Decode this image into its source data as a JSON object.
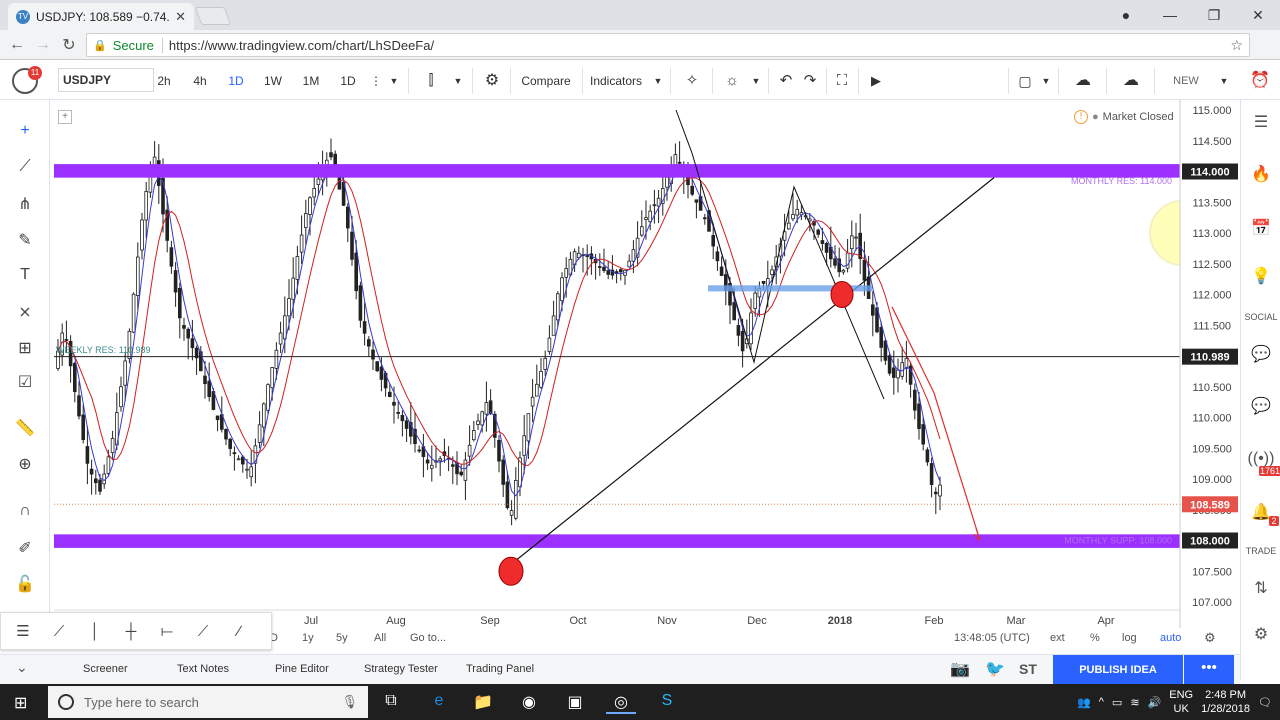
{
  "browser": {
    "tab_title": "USDJPY: 108.589 −0.74...",
    "security_label": "Secure",
    "url": "https://www.tradingview.com/chart/LhSDeeFa/"
  },
  "toolbar": {
    "logo_badge": "11",
    "symbol": "USDJPY",
    "intervals": [
      "2h",
      "4h",
      "1D",
      "1W",
      "1M",
      "1D"
    ],
    "active_interval": "1D",
    "compare": "Compare",
    "indicators": "Indicators",
    "new_label": "NEW"
  },
  "chart_info": {
    "market_status": "Market Closed",
    "current_price": "108.589",
    "monthly_res_label": "MONTHLY RES: 114.000",
    "weekly_res_label": "WEEKLY RES: 110.989",
    "monthly_supp_label": "MONTHLY SUPP: 108.000",
    "price_114": "114.000",
    "price_110989": "110.989",
    "price_108": "108.000",
    "price_108589": "108.589"
  },
  "chart_data": {
    "type": "candlestick",
    "y_ticks": [
      "115.000",
      "114.500",
      "114.000",
      "113.500",
      "113.000",
      "112.500",
      "112.000",
      "111.500",
      "111.000",
      "110.500",
      "110.000",
      "109.500",
      "109.000",
      "108.500",
      "108.000",
      "107.500",
      "107.000"
    ],
    "ylim": [
      107.0,
      115.0
    ],
    "x_ticks": [
      "Jul",
      "Aug",
      "Sep",
      "Oct",
      "Nov",
      "Dec",
      "2018",
      "Feb",
      "Mar",
      "Apr"
    ],
    "resistance_levels": [
      114.0,
      110.989
    ],
    "support_levels": [
      108.0
    ],
    "last_price": 108.589,
    "grid": false
  },
  "bottom_controls": {
    "ranges": [
      "D",
      "1y",
      "5y",
      "All"
    ],
    "goto": "Go to...",
    "time": "13:48:05 (UTC)",
    "ext": "ext",
    "percent": "%",
    "log": "log",
    "auto": "auto"
  },
  "panels": {
    "screener": "Screener",
    "text_notes": "Text Notes",
    "pine_editor": "Pine Editor",
    "strategy_tester": "Strategy Tester",
    "trading_panel": "Trading Panel",
    "st_label": "ST",
    "publish": "PUBLISH IDEA"
  },
  "sidebar": {
    "social": "SOCIAL",
    "trade": "TRADE",
    "badge": "1761",
    "badge2": "2"
  },
  "taskbar": {
    "search_placeholder": "Type here to search",
    "lang": "ENG",
    "region": "UK",
    "time": "2:48 PM",
    "date": "1/28/2018"
  }
}
